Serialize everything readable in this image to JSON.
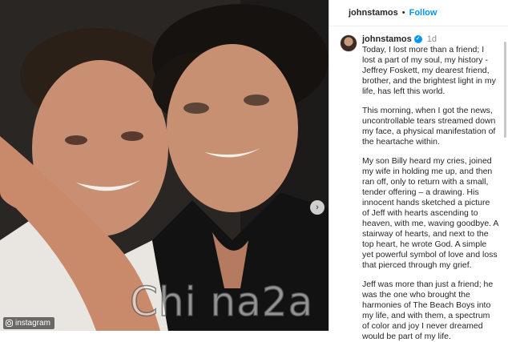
{
  "photo": {
    "next_glyph": "›",
    "credit_text": "instagram",
    "watermark_text": "Chi na2a"
  },
  "header": {
    "username": "johnstamos",
    "separator": "•",
    "follow_label": "Follow"
  },
  "post": {
    "username": "johnstamos",
    "verified_glyph": "✓",
    "time_ago": "1d",
    "paragraphs": [
      "Today, I lost more than a friend; I lost a part of my soul, my history - Jeffrey Foskett, my dearest friend, brother, and the brightest light in my life, has left this world.",
      "This morning, when I got the news, uncontrollable tears streamed down my face, a physical manifestation of the heartache within.",
      "My son Billy heard my cries, joined my wife in holding me up, and then ran off, only to return with a small, tender offering – a drawing. His innocent hands sketched a picture of Jeff with hearts ascending to heaven, with me, waving goodbye. A stairway of hearts, and next to the top heart, he wrote God. A simple yet powerful symbol of love and loss that pierced through my grief.",
      "Jeff was more than just a friend; he was the one who brought the harmonies of The Beach Boys into my life, and with them, a spectrum of color and joy I never dreamed would be part of my life."
    ]
  },
  "icons": {
    "next": "chevron-right-icon",
    "credit": "instagram-icon",
    "verified": "verified-badge-icon"
  },
  "colors": {
    "follow": "#0095f6",
    "verified": "#0095f6",
    "username": "#262626",
    "muted": "#8e8e8e"
  }
}
